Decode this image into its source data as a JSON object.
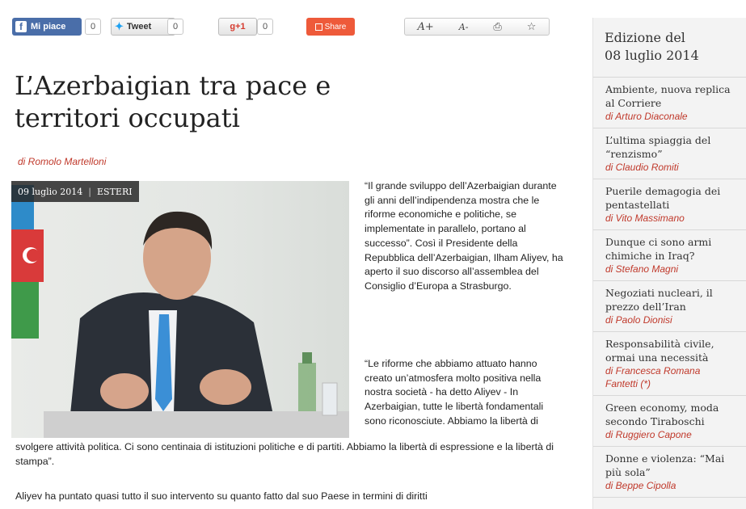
{
  "social": {
    "facebook_label": "Mi piace",
    "facebook_count": "0",
    "tweet_label": "Tweet",
    "tweet_count": "0",
    "gplus_label": "g+1",
    "gplus_count": "0",
    "share_label": "Share"
  },
  "tools": {
    "font_increase": "A+",
    "font_decrease": "A-",
    "print_icon": "print-icon",
    "favorite_icon": "star-icon"
  },
  "article": {
    "title": "L’Azerbaigian tra pace e territori occupati",
    "byline": "di Romolo Martelloni",
    "date": "09 luglio 2014",
    "category": "ESTERI",
    "para1": "“Il grande sviluppo dell’Azerbaigian durante gli anni dell’indipendenza mostra che le riforme economiche e politiche, se implementate in parallelo, portano al successo”. Così il Presidente della Repubblica dell’Azerbaigian, Ilham Aliyev, ha aperto il suo discorso all’assemblea del Consiglio d’Europa a Strasburgo.",
    "para2": "“Le riforme che abbiamo attuato hanno creato un’atmosfera molto positiva nella nostra società - ha detto Aliyev - In Azerbaigian, tutte le libertà fondamentali sono riconosciute. Abbiamo la libertà di",
    "para2_cont": "svolgere attività politica. Ci sono centinaia di istituzioni politiche e di partiti. Abbiamo la libertà di espressione e la libertà di stampa”.",
    "para3": "Aliyev ha puntato quasi tutto il suo intervento su quanto fatto dal suo Paese in termini di diritti"
  },
  "sidebar": {
    "edition_line1": "Edizione del",
    "edition_line2": "08 luglio 2014",
    "items": [
      {
        "title": "Ambiente, nuova replica al Corriere",
        "author": "di Arturo Diaconale"
      },
      {
        "title": "L’ultima spiaggia del “renzismo”",
        "author": "di Claudio Romiti"
      },
      {
        "title": "Puerile demagogia dei pentastellati",
        "author": "di Vito Massimano"
      },
      {
        "title": "Dunque ci sono armi chimiche in Iraq?",
        "author": "di Stefano Magni"
      },
      {
        "title": "Negoziati nucleari, il prezzo dell’Iran",
        "author": "di Paolo Dionisi"
      },
      {
        "title": "Responsabilità civile, ormai una necessità",
        "author": "di Francesca Romana Fantetti (*)"
      },
      {
        "title": "Green economy, moda secondo Tiraboschi",
        "author": "di Ruggiero Capone"
      },
      {
        "title": "Donne e violenza: “Mai più sola”",
        "author": "di Beppe Cipolla"
      }
    ]
  },
  "colors": {
    "accent": "#c0392b",
    "facebook": "#4a6ea9",
    "share": "#ee5a3a"
  }
}
